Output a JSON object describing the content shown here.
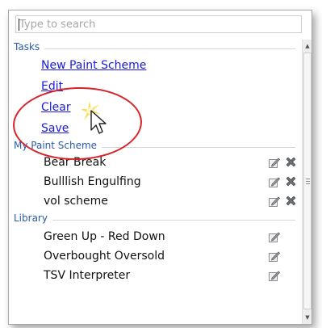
{
  "search": {
    "placeholder": "Type to search"
  },
  "sections": {
    "tasks": {
      "title": "Tasks",
      "items": [
        "New Paint Scheme",
        "Edit",
        "Clear",
        "Save"
      ]
    },
    "my_paint_scheme": {
      "title": "My Paint Scheme",
      "items": [
        "Bear Break",
        "Bulllish Engulfing",
        "vol scheme"
      ]
    },
    "library": {
      "title": "Library",
      "items": [
        "Green Up  - Red Down",
        "Overbought Oversold",
        "TSV Interpreter"
      ]
    }
  },
  "colors": {
    "link": "#1a1ae6",
    "section_title": "#2b5aa8",
    "highlight_ellipse": "#d8232a"
  },
  "icons": {
    "edit": "edit-pencil-icon",
    "delete": "delete-x-icon"
  }
}
